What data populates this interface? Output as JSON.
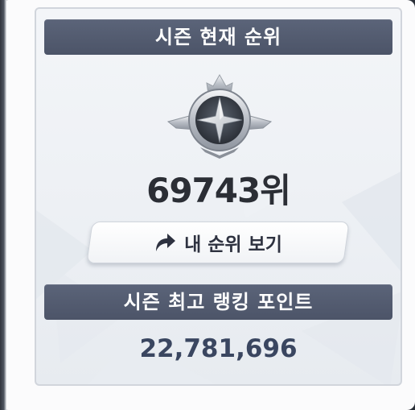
{
  "season_rank": {
    "header": "시즌 현재 순위",
    "rank_text": "69743위",
    "my_rank_button": "내 순위 보기"
  },
  "season_points": {
    "header": "시즌 최고 랭킹 포인트",
    "value": "22,781,696"
  },
  "icons": {
    "emblem": "silver-star-rank-emblem-icon",
    "button": "share-arrow-icon"
  },
  "colors": {
    "header_bar": "#535b70",
    "rank_text": "#2b2e35",
    "points_text": "#3a4660",
    "card_bg": "#eef1f5"
  }
}
